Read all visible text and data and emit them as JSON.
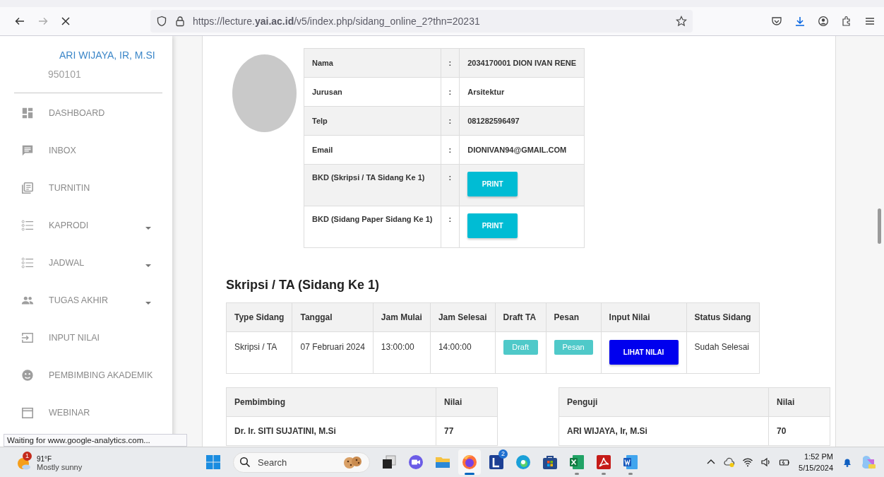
{
  "browser": {
    "url": "https://lecture.**yai.ac.id**/v5/index.php/sidang_online_2?thn=20231",
    "status_text": "Waiting for www.google-analytics.com..."
  },
  "sidebar": {
    "user_name": "ARI WIJAYA, IR, M.SI",
    "user_id": "950101",
    "items": [
      {
        "kind": "dashboard",
        "label": "DASHBOARD",
        "expandable": false
      },
      {
        "kind": "inbox",
        "label": "INBOX",
        "expandable": false
      },
      {
        "kind": "document",
        "label": "TURNITIN",
        "expandable": false
      },
      {
        "kind": "list",
        "label": "KAPRODI",
        "expandable": true
      },
      {
        "kind": "list",
        "label": "JADWAL",
        "expandable": true
      },
      {
        "kind": "people",
        "label": "TUGAS AKHIR",
        "expandable": true
      },
      {
        "kind": "input",
        "label": "INPUT NILAI",
        "expandable": false
      },
      {
        "kind": "face",
        "label": "PEMBIMBING AKADEMIK",
        "expandable": false
      },
      {
        "kind": "calendar",
        "label": "WEBINAR",
        "expandable": false
      }
    ]
  },
  "profile": {
    "rows": [
      {
        "kind": "text",
        "label": "Nama",
        "separator": ":",
        "value": "2034170001 DION IVAN RENE"
      },
      {
        "kind": "text",
        "label": "Jurusan",
        "separator": ":",
        "value": "Arsitektur"
      },
      {
        "kind": "text",
        "label": "Telp",
        "separator": ":",
        "value": "081282596497"
      },
      {
        "kind": "text",
        "label": "Email",
        "separator": ":",
        "value": "DIONIVAN94@GMAIL.COM"
      },
      {
        "kind": "button",
        "label": "BKD (Skripsi / TA Sidang Ke 1)",
        "separator": ":",
        "value": "PRINT"
      },
      {
        "kind": "button",
        "label": "BKD (Sidang Paper Sidang Ke 1)",
        "separator": ":",
        "value": "PRINT"
      }
    ]
  },
  "session": {
    "title": "Skripsi / TA (Sidang Ke 1)",
    "columns": [
      "Type Sidang",
      "Tanggal",
      "Jam Mulai",
      "Jam Selesai",
      "Draft TA",
      "Pesan",
      "Input Nilai",
      "Status Sidang"
    ],
    "row": [
      {
        "kind": "text",
        "value": "Skripsi / TA"
      },
      {
        "kind": "text",
        "value": "07 Februari 2024"
      },
      {
        "kind": "text",
        "value": "13:00:00"
      },
      {
        "kind": "text",
        "value": "14:00:00"
      },
      {
        "kind": "small-button",
        "value": "Draft"
      },
      {
        "kind": "small-button",
        "value": "Pesan"
      },
      {
        "kind": "primary-button",
        "value": "LIHAT NILAI"
      },
      {
        "kind": "text",
        "value": "Sudah Selesai"
      }
    ]
  },
  "pembimbing": {
    "columns": [
      "Pembimbing",
      "Nilai"
    ],
    "rows": [
      [
        "Dr. Ir. SITI SUJATINI, M.Si",
        "77"
      ]
    ]
  },
  "penguji": {
    "columns": [
      "Penguji",
      "Nilai"
    ],
    "rows": [
      [
        "ARI WIJAYA, Ir, M.Si",
        "70"
      ]
    ]
  },
  "taskbar": {
    "weather": {
      "badge": "1",
      "temp": "91°F",
      "condition": "Mostly sunny"
    },
    "search_placeholder": "Search",
    "apps": [
      {
        "kind": "taskview",
        "selected": false,
        "running": false
      },
      {
        "kind": "chat",
        "selected": false,
        "running": false
      },
      {
        "kind": "folder",
        "selected": false,
        "running": false
      },
      {
        "kind": "firefox",
        "selected": true,
        "running": true
      },
      {
        "kind": "letter-l",
        "selected": false,
        "running": false,
        "badge": "2"
      },
      {
        "kind": "edge",
        "selected": false,
        "running": false
      },
      {
        "kind": "store",
        "selected": false,
        "running": false
      },
      {
        "kind": "excel",
        "selected": false,
        "running": true
      },
      {
        "kind": "acrobat",
        "selected": false,
        "running": true
      },
      {
        "kind": "word",
        "selected": false,
        "running": true
      }
    ],
    "time": "1:52 PM",
    "date": "5/15/2024"
  }
}
